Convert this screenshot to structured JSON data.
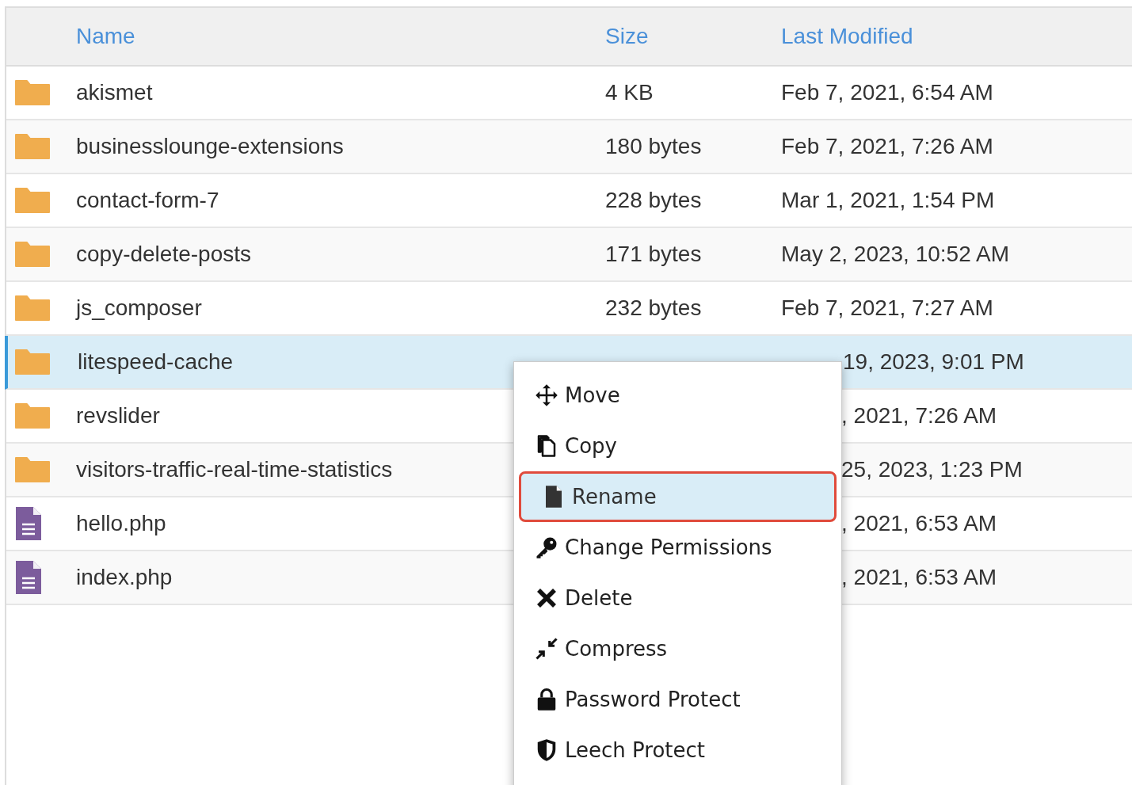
{
  "table": {
    "columns": [
      "Name",
      "Size",
      "Last Modified"
    ],
    "rows": [
      {
        "kind": "folder",
        "name": "akismet",
        "size": "4 KB",
        "modified": "Feb 7, 2021, 6:54 AM",
        "selected": false
      },
      {
        "kind": "folder",
        "name": "businesslounge-extensions",
        "size": "180 bytes",
        "modified": "Feb 7, 2021, 7:26 AM",
        "selected": false
      },
      {
        "kind": "folder",
        "name": "contact-form-7",
        "size": "228 bytes",
        "modified": "Mar 1, 2021, 1:54 PM",
        "selected": false
      },
      {
        "kind": "folder",
        "name": "copy-delete-posts",
        "size": "171 bytes",
        "modified": "May 2, 2023, 10:52 AM",
        "selected": false
      },
      {
        "kind": "folder",
        "name": "js_composer",
        "size": "232 bytes",
        "modified": "Feb 7, 2021, 7:27 AM",
        "selected": false
      },
      {
        "kind": "folder",
        "name": "litespeed-cache",
        "modified": "19, 2023, 9:01 PM",
        "selected": true
      },
      {
        "kind": "folder",
        "name": "revslider",
        "modified": ", 2021, 7:26 AM",
        "selected": false
      },
      {
        "kind": "folder",
        "name": "visitors-traffic-real-time-statistics",
        "modified": "25, 2023, 1:23 PM",
        "selected": false
      },
      {
        "kind": "file",
        "name": "hello.php",
        "modified": ", 2021, 6:53 AM",
        "selected": false
      },
      {
        "kind": "file",
        "name": "index.php",
        "modified": ", 2021, 6:53 AM",
        "selected": false
      }
    ]
  },
  "context_menu": {
    "items": [
      {
        "label": "Move",
        "selected": false
      },
      {
        "label": "Copy",
        "selected": false
      },
      {
        "label": "Rename",
        "selected": true
      },
      {
        "label": "Change Permissions",
        "selected": false
      },
      {
        "label": "Delete",
        "selected": false
      },
      {
        "label": "Compress",
        "selected": false
      },
      {
        "label": "Password Protect",
        "selected": false
      },
      {
        "label": "Leech Protect",
        "selected": false
      }
    ]
  }
}
